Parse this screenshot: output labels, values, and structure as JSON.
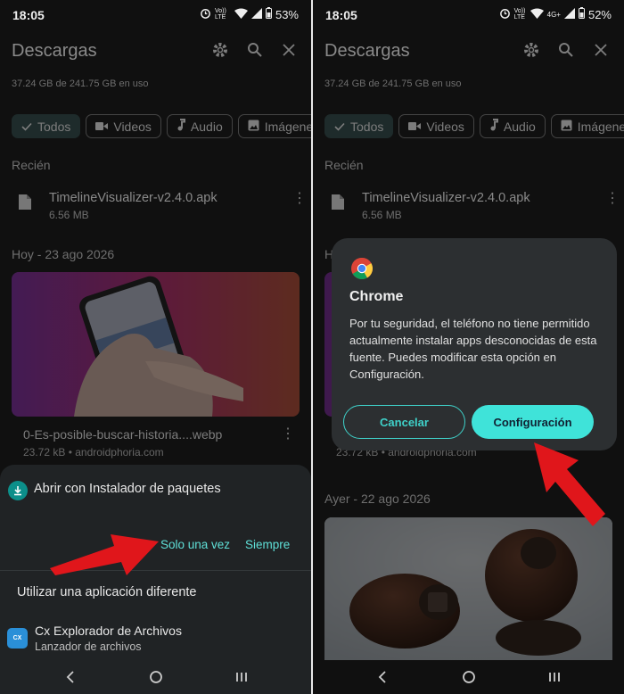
{
  "left": {
    "status": {
      "time": "18:05",
      "net": "Vo)) LTE",
      "battery": "53%"
    },
    "header": {
      "title": "Descargas"
    },
    "storage": "37.24 GB de 241.75 GB en uso",
    "chips": [
      "Todos",
      "Videos",
      "Audio",
      "Imágenes"
    ],
    "recent_label": "Recién",
    "recent_file": {
      "name": "TimelineVisualizer-v2.4.0.apk",
      "size": "6.56 MB"
    },
    "today_label": "Hoy - 23 ago 2026",
    "image_file": {
      "name": "0-Es-posible-buscar-historia....webp",
      "size": "23.72 kB • androidphoria.com"
    },
    "sheet": {
      "open_with": "Abrir con Instalador de paquetes",
      "once": "Solo una vez",
      "always": "Siempre",
      "other_app": "Utilizar una aplicación diferente",
      "app_name": "Cx Explorador de Archivos",
      "app_sub": "Lanzador de archivos",
      "app_badge": "CX"
    }
  },
  "right": {
    "status": {
      "time": "18:05",
      "net": "4G+",
      "battery": "52%"
    },
    "header": {
      "title": "Descargas"
    },
    "storage": "37.24 GB de 241.75 GB en uso",
    "chips": [
      "Todos",
      "Videos",
      "Audio",
      "Imágenes"
    ],
    "recent_label": "Recién",
    "recent_file": {
      "name": "TimelineVisualizer-v2.4.0.apk",
      "size": "6.56 MB"
    },
    "today_label": "H",
    "image_size": "23.72 kB • androidphoria.com",
    "yesterday_label": "Ayer - 22 ago 2026",
    "dialog": {
      "title": "Chrome",
      "body": "Por tu seguridad, el teléfono no tiene permitido actualmente instalar apps desconocidas de esta fuente. Puedes modificar esta opción en Configuración.",
      "cancel": "Cancelar",
      "settings": "Configuración"
    }
  },
  "colors": {
    "accent": "#3fe3d9",
    "arrow": "#e0161b",
    "sheet_bg": "#202325"
  }
}
